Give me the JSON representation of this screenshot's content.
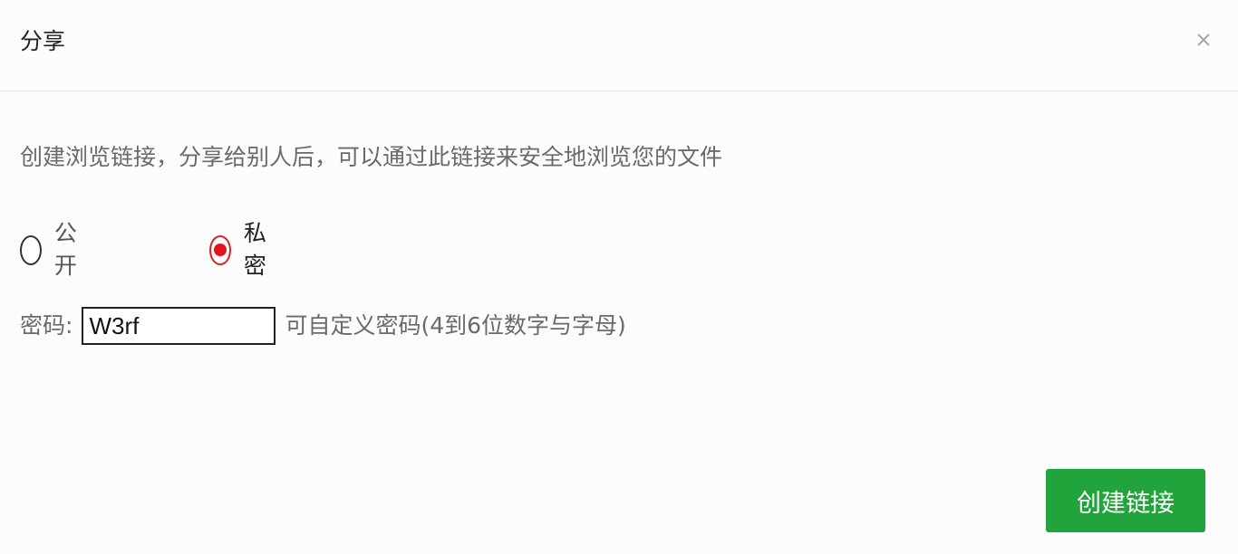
{
  "dialog": {
    "title": "分享",
    "close_icon": "close-icon"
  },
  "description": "创建浏览链接，分享给别人后，可以通过此链接来安全地浏览您的文件",
  "visibility": {
    "options": [
      {
        "label": "公开",
        "checked": false
      },
      {
        "label": "私密",
        "checked": true
      }
    ],
    "accent_color": "#e3131b"
  },
  "password": {
    "label": "密码:",
    "value": "W3rf",
    "hint": "可自定义密码(4到6位数字与字母)"
  },
  "actions": {
    "create_label": "创建链接",
    "create_color": "#22a43c"
  }
}
